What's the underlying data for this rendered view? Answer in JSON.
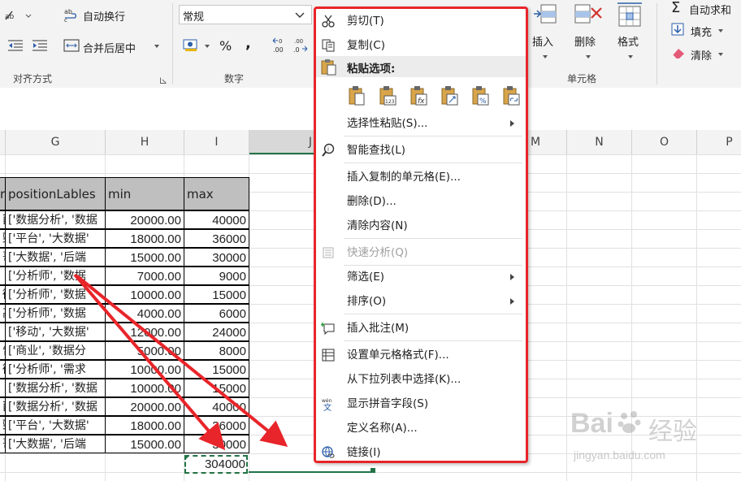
{
  "ribbon": {
    "wrap_text": "自动换行",
    "merge_center": "合并后居中",
    "align_group": "对齐方式",
    "number_format": "常规",
    "percent": "%",
    "comma": ",",
    "dec_inc": ".00",
    "dec_dec": ".0",
    "number_group": "数字",
    "insert": "插入",
    "delete": "删除",
    "format": "格式",
    "cells_group": "单元格",
    "autosum": "自动求和",
    "fill": "填充",
    "clear": "清除"
  },
  "columns": [
    "G",
    "H",
    "I",
    "J",
    "M",
    "N",
    "O",
    "P"
  ],
  "table": {
    "headers": [
      "positionLables",
      "min",
      "max"
    ],
    "rows": [
      {
        "left": "酉",
        "labels": "['数据分析', '数据",
        "min": "20000.00",
        "max": "40000"
      },
      {
        "left": "勁",
        "labels": "['平台', '大数据'",
        "min": "18000.00",
        "max": "36000"
      },
      {
        "left": "哥",
        "labels": "['大数据', '后端",
        "min": "15000.00",
        "max": "30000"
      },
      {
        "left": "",
        "labels": "['分析师', '数据",
        "min": "7000.00",
        "max": "9000"
      },
      {
        "left": "徵",
        "labels": "['分析师', '数据",
        "min": "10000.00",
        "max": "15000"
      },
      {
        "left": "高",
        "labels": "['分析师', '数据",
        "min": "4000.00",
        "max": "6000"
      },
      {
        "left": "",
        "labels": "['移动', '大数据'",
        "min": "12000.00",
        "max": "24000"
      },
      {
        "left": "告",
        "labels": "['商业', '数据分",
        "min": "5000.00",
        "max": "8000"
      },
      {
        "left": "徵",
        "labels": "['分析师', '需求",
        "min": "10000.00",
        "max": "15000"
      },
      {
        "left": "",
        "labels": "['数据分析', '数据",
        "min": "10000.00",
        "max": "15000"
      },
      {
        "left": "酉",
        "labels": "['数据分析', '数据",
        "min": "20000.00",
        "max": "40000"
      },
      {
        "left": "勁",
        "labels": "['平台', '大数据'",
        "min": "18000.00",
        "max": "36000"
      },
      {
        "left": "哥",
        "labels": "['大数据', '后端",
        "min": "15000.00",
        "max": "30000"
      }
    ],
    "left_header": "r",
    "total": "304000"
  },
  "menu": {
    "cut": "剪切(T)",
    "copy": "复制(C)",
    "paste_options": "粘贴选项:",
    "paste_special": "选择性粘贴(S)...",
    "smart_lookup": "智能查找(L)",
    "insert_copied": "插入复制的单元格(E)...",
    "delete": "删除(D)...",
    "clear_contents": "清除内容(N)",
    "quick_analysis": "快速分析(Q)",
    "filter": "筛选(E)",
    "sort": "排序(O)",
    "insert_comment": "插入批注(M)",
    "format_cells": "设置单元格格式(F)...",
    "pick_list": "从下拉列表中选择(K)...",
    "phonetic": "显示拼音字段(S)",
    "define_name": "定义名称(A)...",
    "link": "链接(I)",
    "phonetic_icon_text": "wén"
  },
  "watermark": {
    "brand": "Bai",
    "brand_cn": "经验",
    "url": "jingyan.baidu.com"
  },
  "colors": {
    "highlight": "#e8252a",
    "header_fill": "#bfbfbf",
    "selection": "#217346"
  }
}
